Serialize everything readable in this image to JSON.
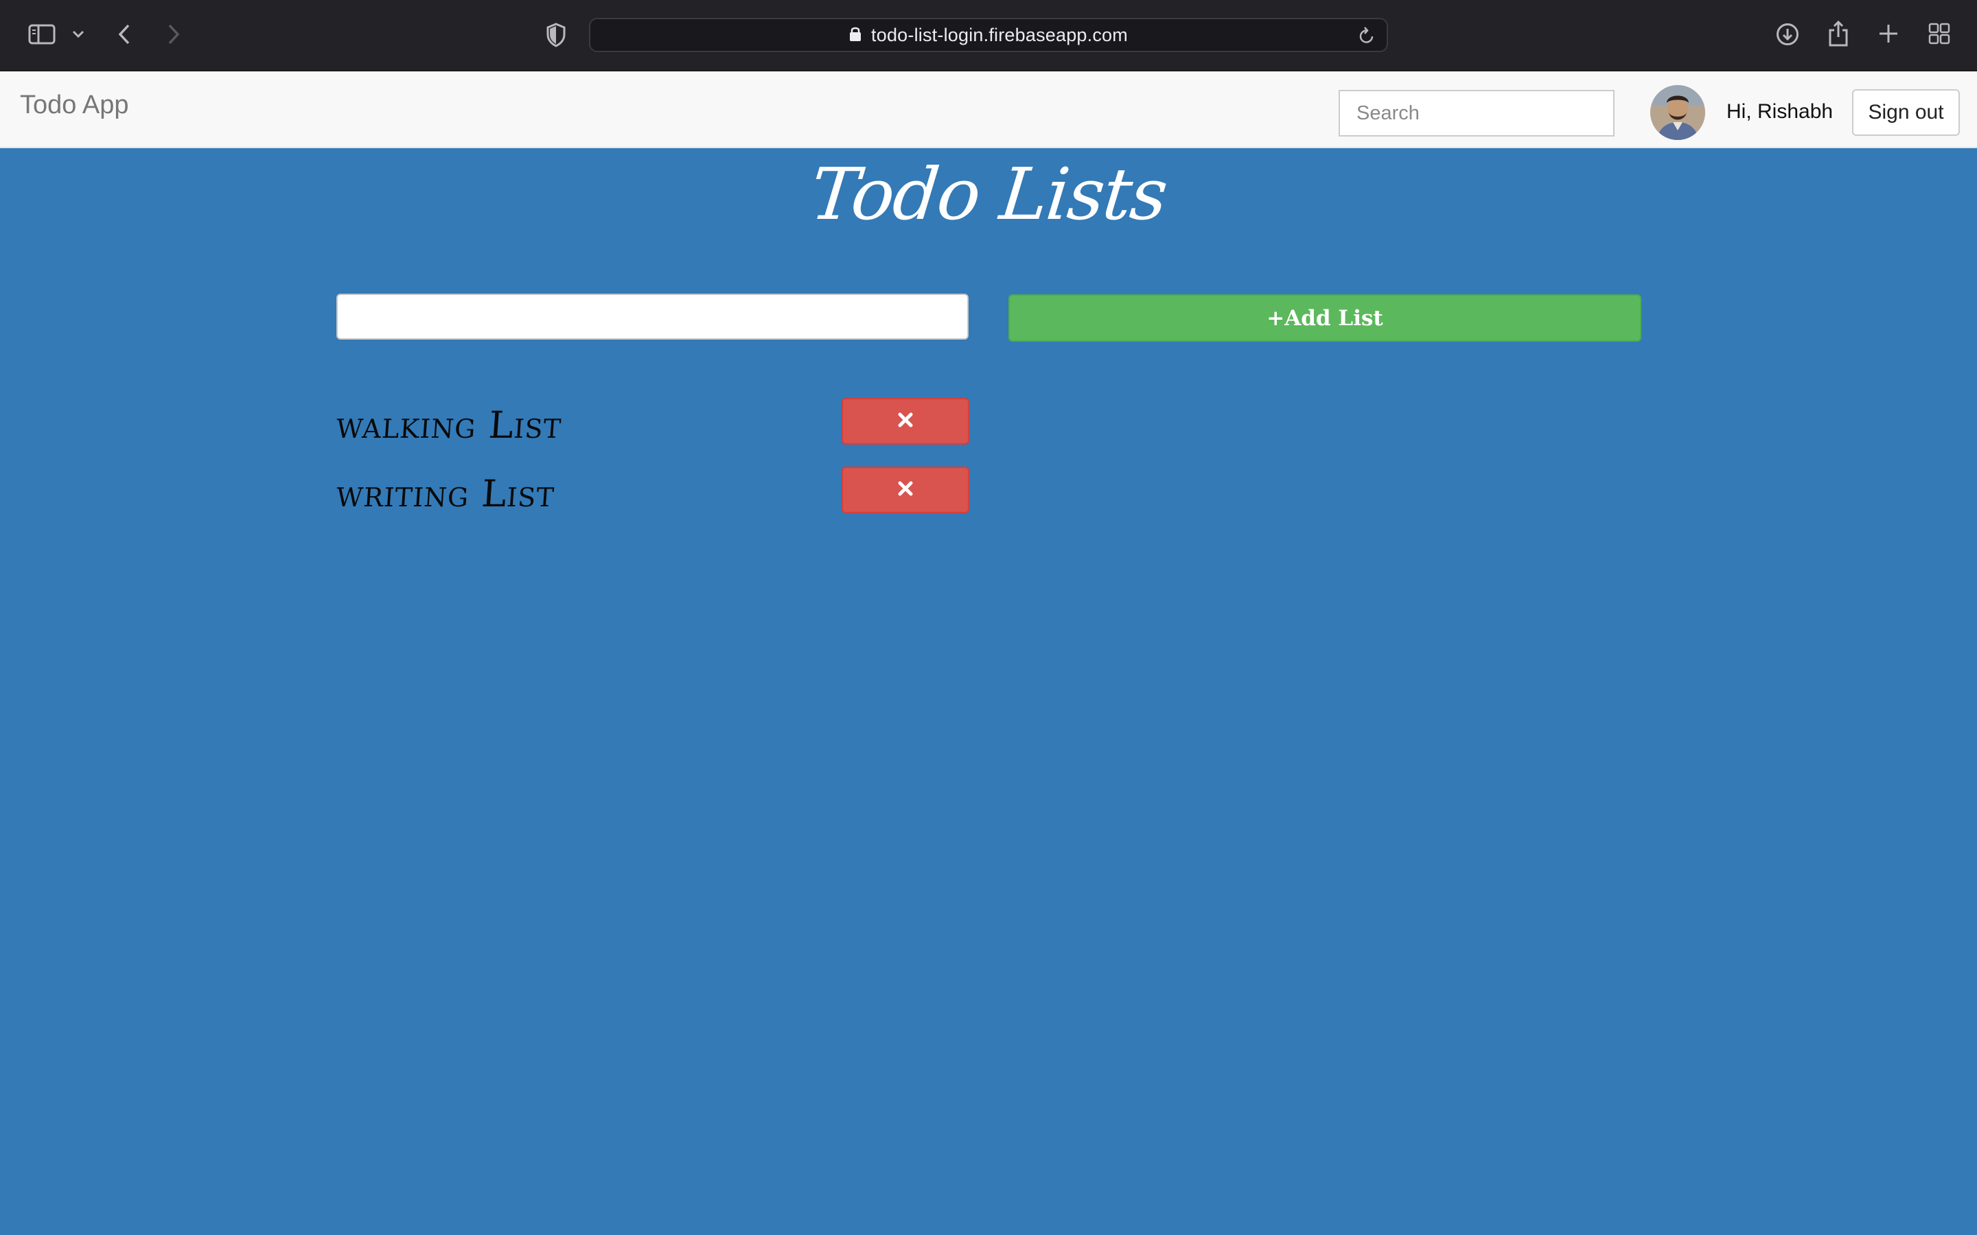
{
  "browser": {
    "url": "todo-list-login.firebaseapp.com",
    "icons": [
      "sidebar-icon",
      "chevron-down-icon",
      "back-icon",
      "forward-icon",
      "shield-icon",
      "lock-icon",
      "reload-icon",
      "download-icon",
      "share-icon",
      "new-tab-icon",
      "tab-overview-icon"
    ]
  },
  "navbar": {
    "brand": "Todo App",
    "search_placeholder": "Search",
    "greeting": "Hi, Rishabh",
    "signout_label": "Sign out"
  },
  "main": {
    "title": "Todo Lists",
    "new_list_value": "",
    "add_list_label": "+Add List",
    "lists": [
      {
        "name": "walking List",
        "delete_icon": "close-icon"
      },
      {
        "name": "writing List",
        "delete_icon": "close-icon"
      }
    ]
  },
  "colors": {
    "main_bg": "#337ab7",
    "add_button": "#5cb85c",
    "delete_button": "#d9534f",
    "navbar_bg": "#f8f8f8",
    "browser_bg": "#232226"
  }
}
